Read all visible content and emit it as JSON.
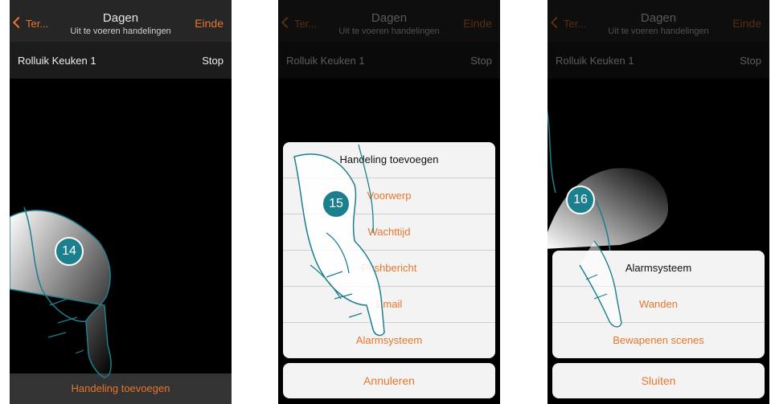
{
  "header": {
    "back_label": "Ter...",
    "title": "Dagen",
    "subtitle": "Uit te voeren handelingen",
    "done_label": "Einde"
  },
  "action_row": {
    "label": "Rolluik Keuken 1",
    "value": "Stop"
  },
  "screen1": {
    "step": "14",
    "add_action_label": "Handeling toevoegen"
  },
  "screen2": {
    "step": "15",
    "sheet_title": "Handeling toevoegen",
    "options": [
      "Voorwerp",
      "Wachttijd",
      "Pushbericht",
      "Email",
      "Alarmsysteem"
    ],
    "options_visible": [
      "Voorwerp",
      "W    ttijd",
      "   sbericht",
      "mail",
      "Alarmsysteem"
    ],
    "cancel_label": "Annuleren"
  },
  "screen3": {
    "step": "16",
    "sheet_title": "Alarmsysteem",
    "options": [
      "Wanden",
      "Bewapenen scenes"
    ],
    "close_label": "Sluiten"
  },
  "colors": {
    "accent": "#e8762c",
    "badge": "#1c7f8e",
    "hand_outline": "#1c7f8e"
  }
}
